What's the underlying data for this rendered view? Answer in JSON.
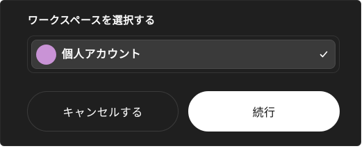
{
  "dialog": {
    "title": "ワークスペースを選択する",
    "workspace_select": {
      "selected_label": "個人アカウント",
      "avatar_color": "#c993d6",
      "check_icon": "check-icon"
    },
    "buttons": {
      "cancel_label": "キャンセルする",
      "continue_label": "続行"
    }
  },
  "colors": {
    "background": "#1f1f1f",
    "select_bg": "#3a3a3a",
    "primary_button": "#ffffff"
  }
}
